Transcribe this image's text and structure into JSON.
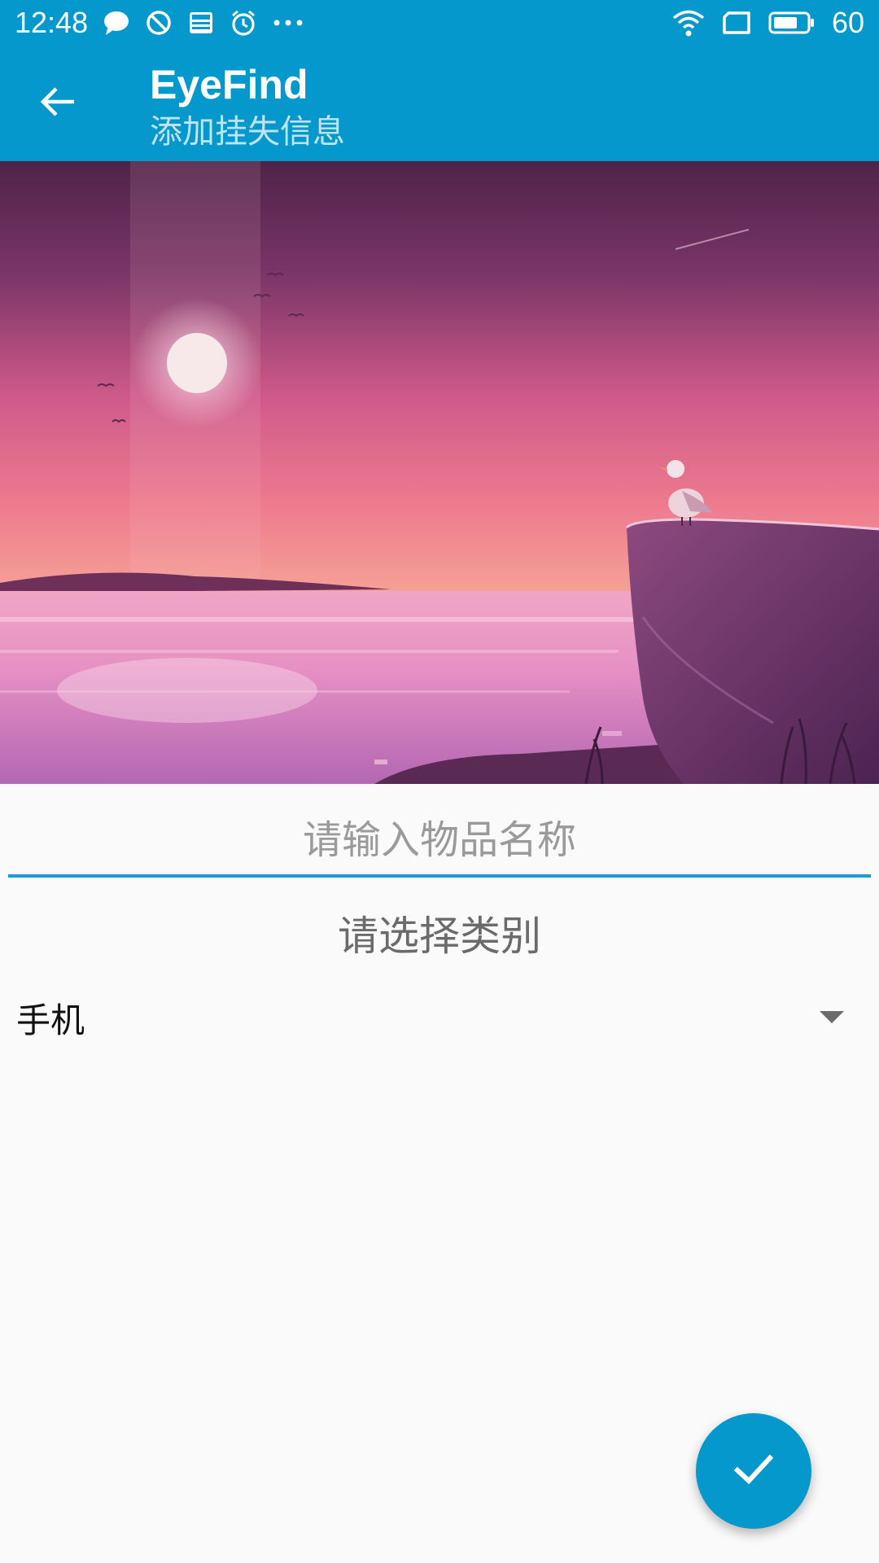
{
  "status_bar": {
    "time": "12:48",
    "battery_level": "60",
    "icons": [
      "chat-bubble-icon",
      "do-not-disturb-icon",
      "news-icon",
      "alarm-icon",
      "more-dots-icon",
      "wifi-icon",
      "sim-icon",
      "battery-icon"
    ]
  },
  "app_bar": {
    "title": "EyeFind",
    "subtitle": "添加挂失信息",
    "back_icon": "arrow-back-icon"
  },
  "form": {
    "name_placeholder": "请输入物品名称",
    "name_value": "",
    "category_label": "请选择类别",
    "category_selected": "手机"
  },
  "fab": {
    "icon": "check-icon"
  },
  "colors": {
    "primary": "#0498cc",
    "accent_underline": "#1b9bd1",
    "background": "#fafafa"
  }
}
